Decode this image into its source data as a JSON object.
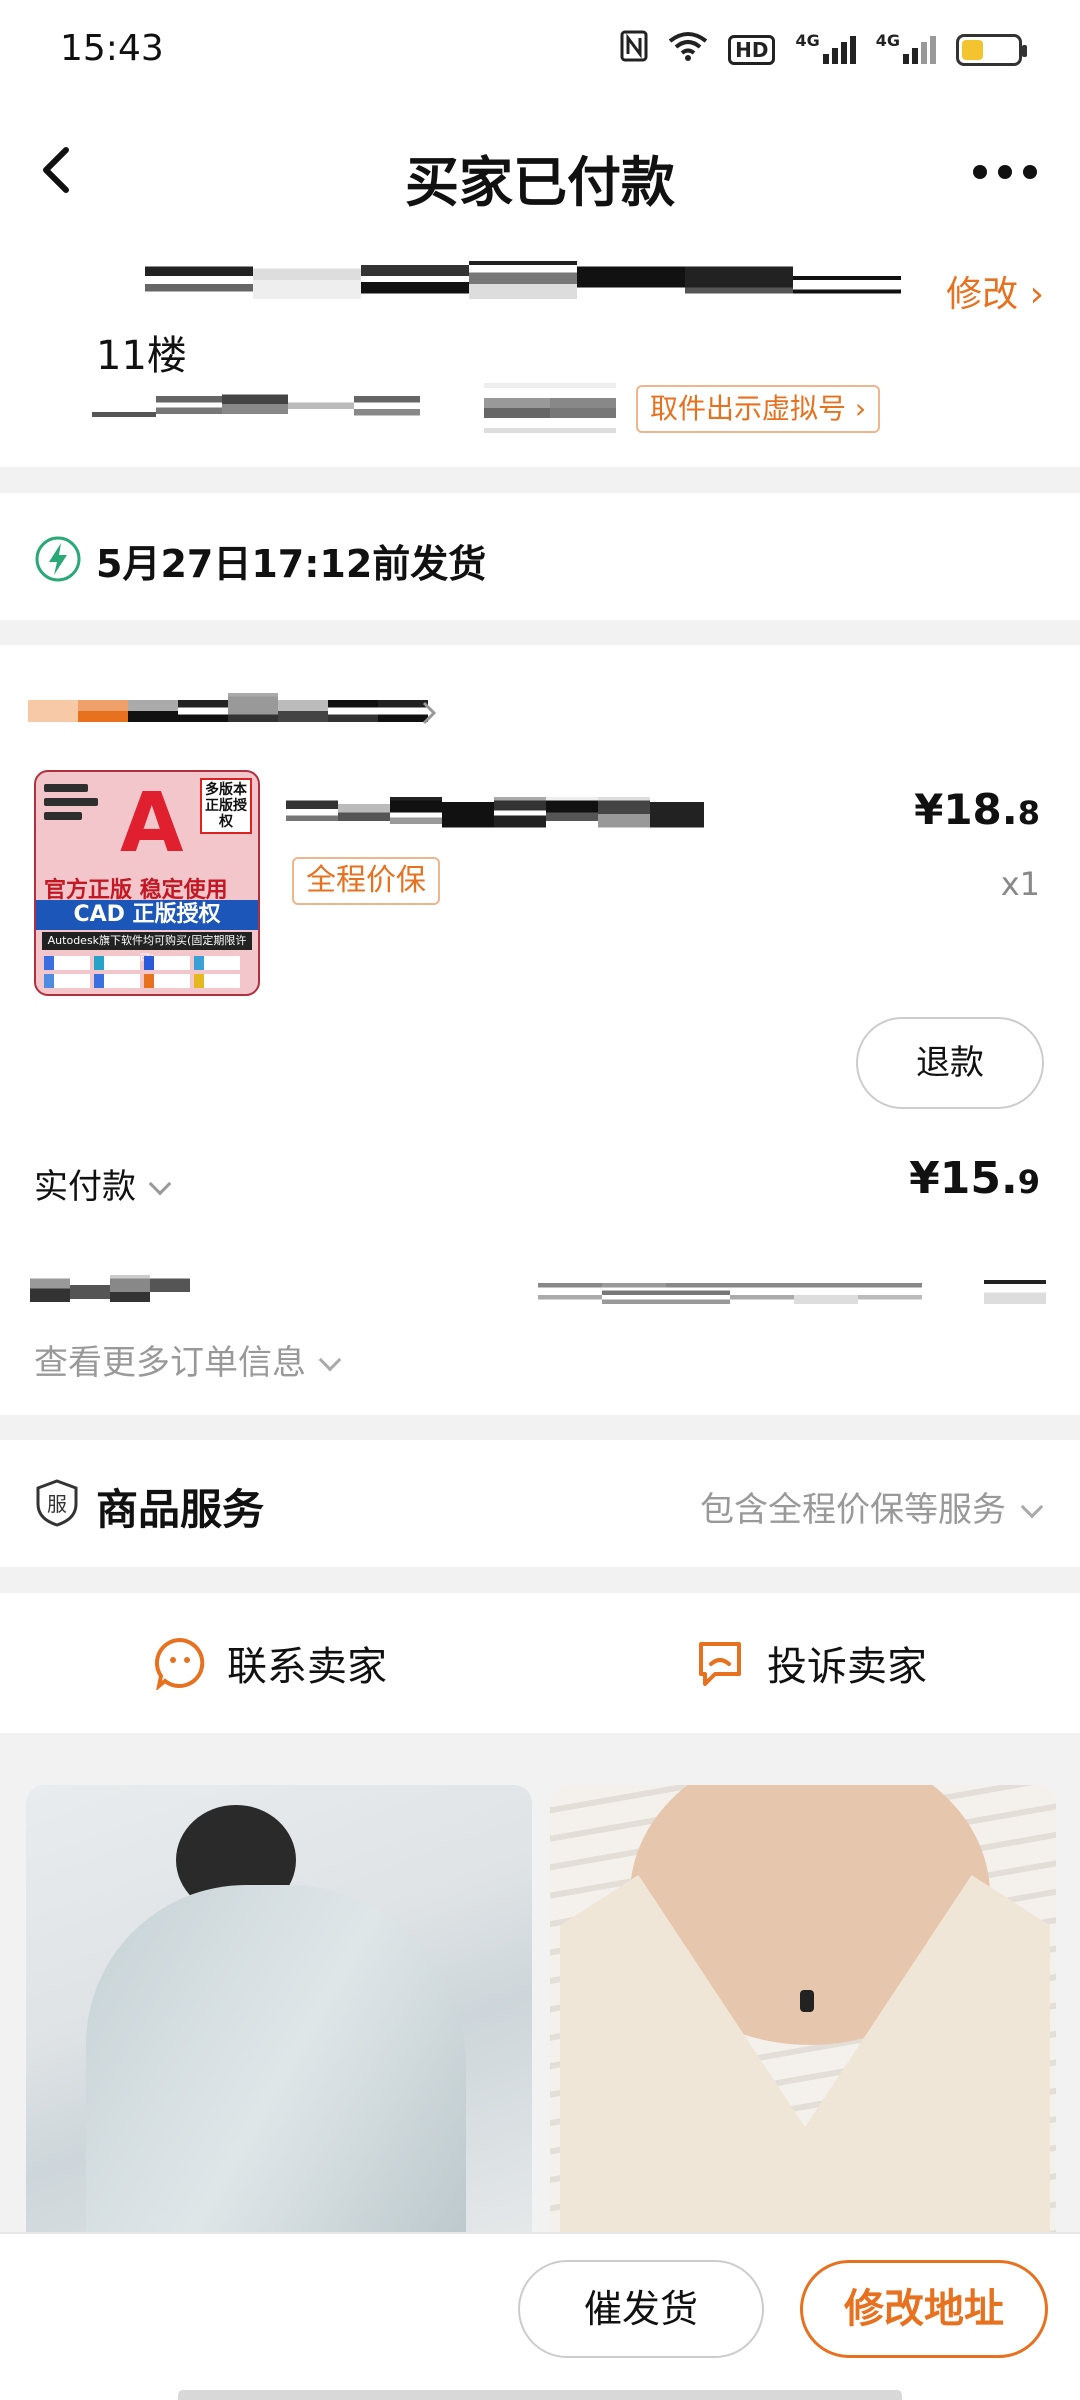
{
  "status_bar": {
    "time": "15:43",
    "icons": [
      "nfc-icon",
      "wifi-icon",
      "hd-icon",
      "signal-4g-icon",
      "signal-4g-icon",
      "battery-icon"
    ],
    "network_label_1": "4G",
    "network_label_2": "4G",
    "hd_label": "HD",
    "battery_level": 0.35
  },
  "nav": {
    "title": "买家已付款"
  },
  "address": {
    "edit_label": "修改 ›",
    "floor": "11楼",
    "virtual_number_button": "取件出示虚拟号 ›"
  },
  "shipping": {
    "text": "5月27日17:12前发货"
  },
  "order": {
    "product_badge": "全程价保",
    "price_main": "¥18.",
    "price_decimal": "8",
    "quantity": "x1",
    "refund_button": "退款",
    "paid_label": "实付款",
    "paid_main": "¥15.",
    "paid_decimal": "9",
    "more_info": "查看更多订单信息",
    "thumbnail": {
      "tag": "多版本正版授权",
      "line1": "官方正版 稳定使用",
      "band": "CAD 正版授权",
      "small": "Autodesk旗下软件均可购买(固定期限许可)",
      "logo_letter": "A"
    }
  },
  "service": {
    "label": "商品服务",
    "detail": "包含全程价保等服务"
  },
  "contact": {
    "seller": "联系卖家",
    "complain": "投诉卖家"
  },
  "bottom": {
    "urge_button": "催发货",
    "change_address_button": "修改地址"
  },
  "colors": {
    "accent": "#e8711f",
    "ship_icon": "#2aa876"
  }
}
